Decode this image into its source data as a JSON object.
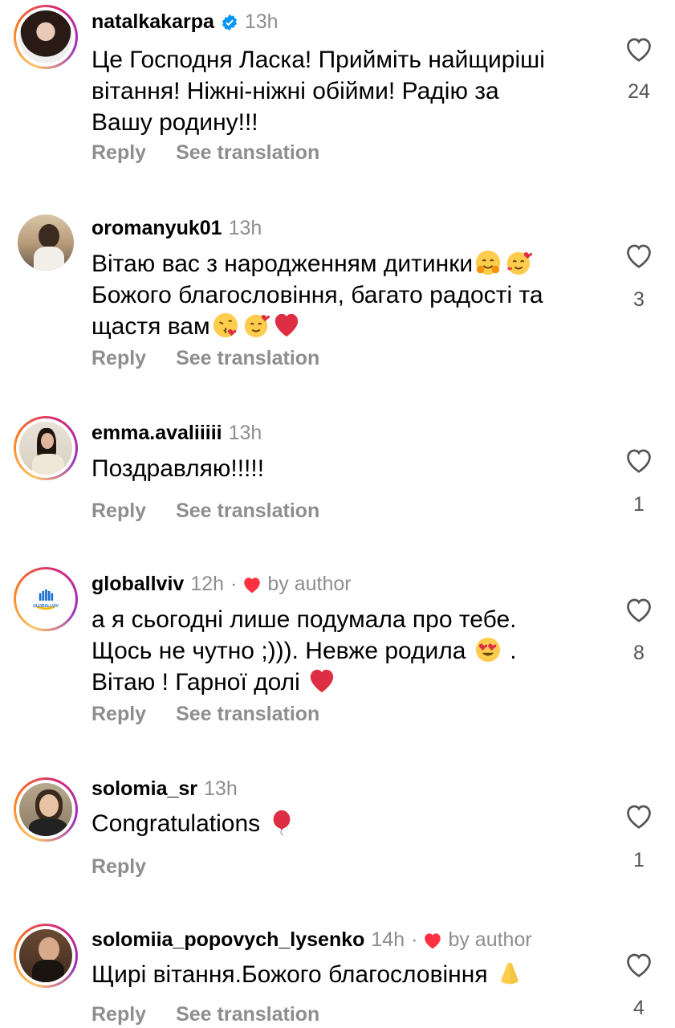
{
  "actions": {
    "reply": "Reply",
    "see_translation": "See translation"
  },
  "comments": [
    {
      "username": "natalkakarpa",
      "verified": true,
      "time": "13h",
      "text_lines": [
        "Це Господня Ласка! Прийміть найщиріші",
        "вітання! Ніжні-ніжні обійми! Радію за",
        "Вашу родину!!!"
      ],
      "likes": "24",
      "by_author": false
    },
    {
      "username": "oromanyuk01",
      "verified": false,
      "time": "13h",
      "text_lines": [
        "Вітаю вас з народженням дитинки",
        "Божого благословіння, багато радості та",
        "щастя вам"
      ],
      "likes": "3",
      "by_author": false
    },
    {
      "username": "emma.avaliiiii",
      "verified": false,
      "time": "13h",
      "text_lines": [
        "Поздравляю!!!!!"
      ],
      "likes": "1",
      "by_author": false
    },
    {
      "username": "globallviv",
      "verified": false,
      "time": "12h",
      "by_author_label": "by author",
      "text_lines": [
        "а я сьогодні лише подумала про тебе.",
        "Щось не чутно ;))). Невже родила",
        "Вітаю ! Гарної долі"
      ],
      "likes": "8",
      "by_author": true,
      "avatar_text": "GLOBALLVIV"
    },
    {
      "username": "solomia_sr",
      "verified": false,
      "time": "13h",
      "text_lines": [
        "Congratulations"
      ],
      "likes": "1",
      "by_author": false
    },
    {
      "username": "solomiia_popovych_lysenko",
      "verified": false,
      "time": "14h",
      "by_author_label": "by author",
      "text_lines": [
        "Щирі вітання.Божого благословіння"
      ],
      "likes": "4",
      "by_author": true
    }
  ],
  "colors": {
    "meta": "#8e8e8e",
    "heart_red": "#ff3040",
    "verified_blue": "#0095f6"
  }
}
